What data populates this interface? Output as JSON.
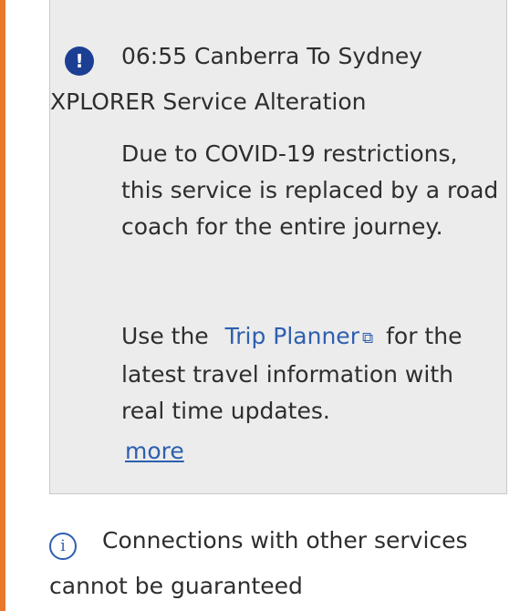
{
  "alert": {
    "icon": "exclamation-circle-icon",
    "badge_glyph": "!",
    "title_line1": "06:55 Canberra To Sydney",
    "title_line2": "XPLORER Service Alteration",
    "paragraph1": "Due to COVID-19 restrictions, this service is replaced by a road coach for the entire journey.",
    "paragraph2_before_link": "Use the",
    "trip_planner_link": "Trip Planner",
    "external_icon": "external-link-icon",
    "external_glyph": "⧉",
    "paragraph2_after_link": "for the latest travel information with real time updates.",
    "more_link": "more"
  },
  "connection_note": {
    "icon": "info-icon",
    "icon_glyph": "i",
    "text": "Connections with other services cannot be guaranteed"
  },
  "colors": {
    "accent_rule": "#e8782a",
    "alert_background": "#ececec",
    "icon_blue": "#1c3f94",
    "link_blue": "#2d5fae"
  }
}
